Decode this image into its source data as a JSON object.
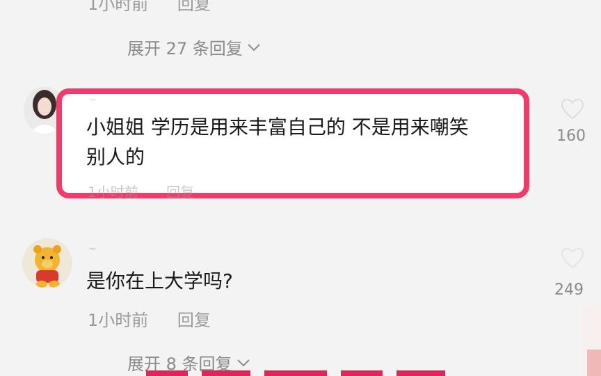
{
  "top_comment": {
    "time": "1小时前",
    "reply_label": "回复",
    "expand_label": "展开 27 条回复"
  },
  "comment1": {
    "username": "~",
    "text_line1": "小姐姐 学历是用来丰富自己的 不是用来嘲笑",
    "text_line2": "别人的",
    "time": "1小时前",
    "reply_label": "回复",
    "likes": "160"
  },
  "comment2": {
    "username": "~",
    "text": "是你在上大学吗?",
    "time": "1小时前",
    "reply_label": "回复",
    "likes": "249",
    "expand_label": "展开 8 条回复"
  },
  "colors": {
    "highlight": "#f23b6a",
    "background": "#f3f3f3"
  },
  "icons": {
    "expand": "chevron-down-icon",
    "like": "heart-icon"
  }
}
